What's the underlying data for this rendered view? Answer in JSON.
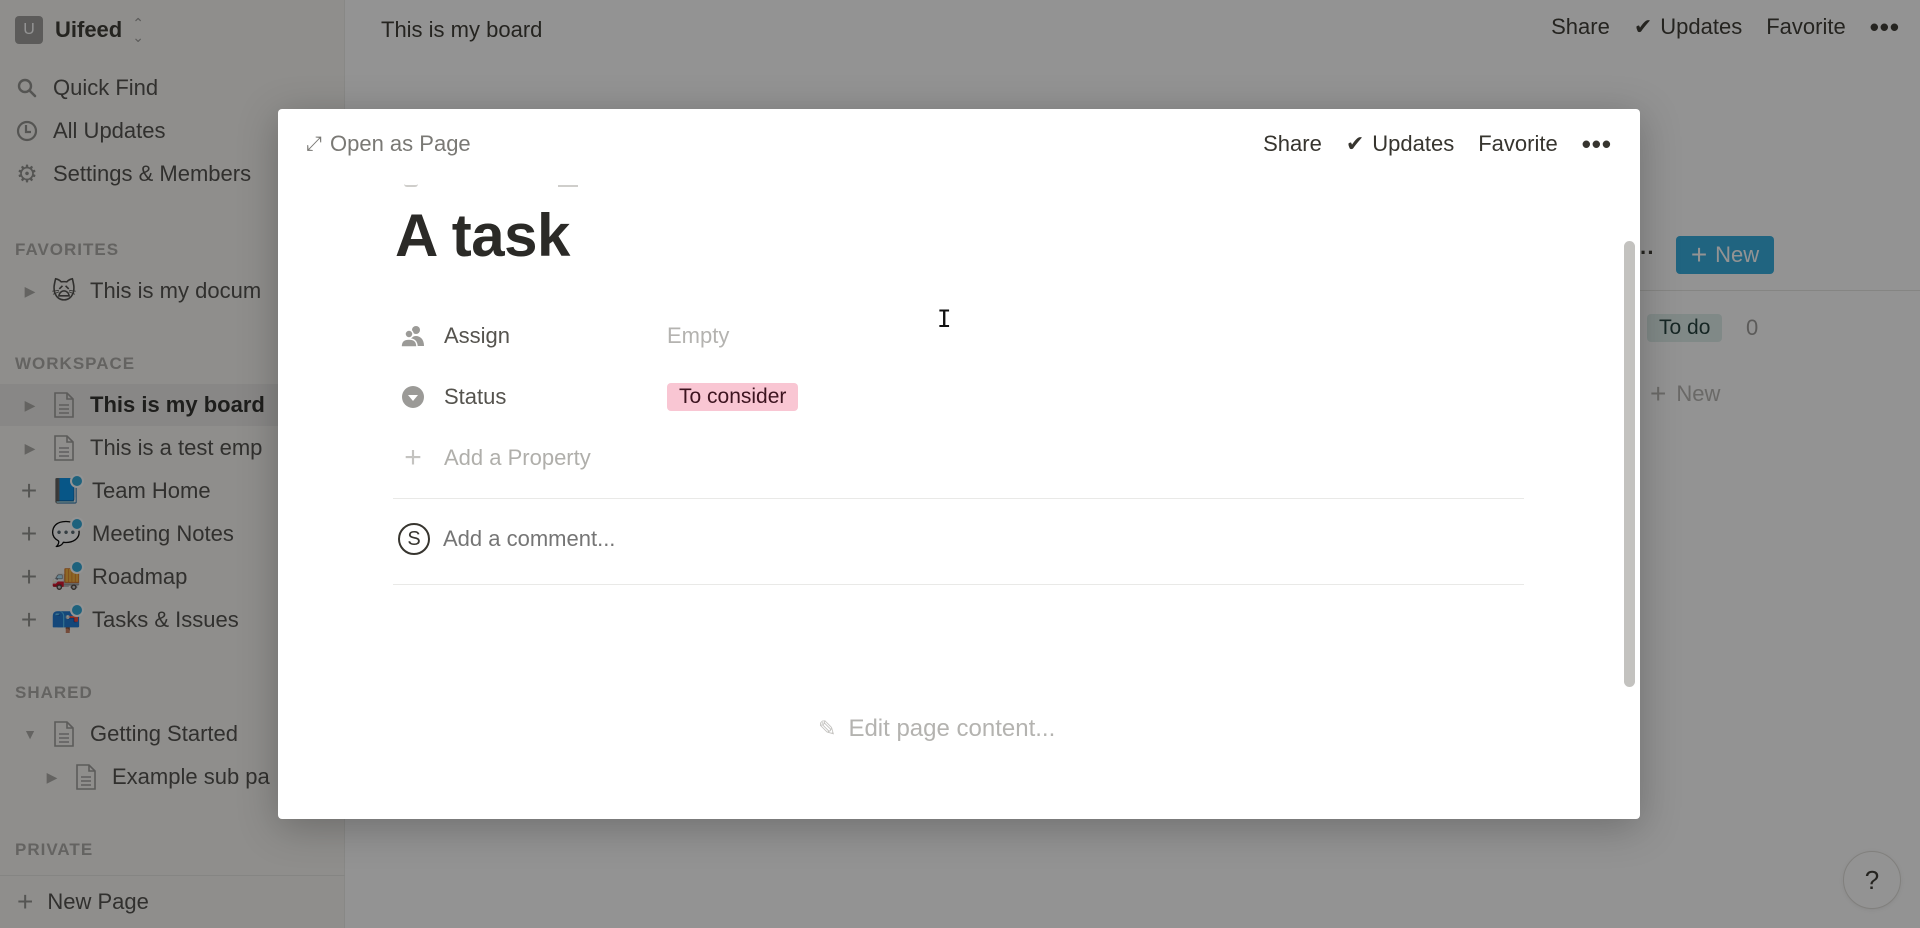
{
  "sidebar": {
    "workspace": {
      "initial": "U",
      "name": "Uifeed"
    },
    "nav": [
      {
        "label": "Quick Find",
        "icon": "search-icon"
      },
      {
        "label": "All Updates",
        "icon": "clock-icon"
      },
      {
        "label": "Settings & Members",
        "icon": "gear-icon"
      }
    ],
    "sections": {
      "favorites": "FAVORITES",
      "workspace": "WORKSPACE",
      "shared": "SHARED",
      "private": "PRIVATE"
    },
    "favorites": [
      {
        "label": "This is my docum",
        "icon": "scared-cat-emoji",
        "emoji": "🙀"
      }
    ],
    "workspace_items": [
      {
        "label": "This is my board",
        "icon": "page-icon",
        "active": true
      },
      {
        "label": "This is a test emp",
        "icon": "page-icon"
      },
      {
        "label": "Team Home",
        "icon": "book-icon",
        "emoji": "📘"
      },
      {
        "label": "Meeting Notes",
        "icon": "speech-bubble-icon",
        "emoji": "💬"
      },
      {
        "label": "Roadmap",
        "icon": "truck-icon",
        "emoji": "🚚"
      },
      {
        "label": "Tasks & Issues",
        "icon": "mailbox-icon",
        "emoji": "📪"
      }
    ],
    "shared_items": [
      {
        "label": "Getting Started",
        "icon": "page-icon",
        "expanded": true
      },
      {
        "label": "Example sub pa",
        "icon": "page-icon"
      }
    ],
    "new_page": "New Page"
  },
  "topbar": {
    "title": "This is my board",
    "share": "Share",
    "updates": "Updates",
    "favorite": "Favorite",
    "more": "•••"
  },
  "board": {
    "new_button": "New",
    "column": {
      "name": "To do",
      "count": "0",
      "color": "#ddedea"
    },
    "add_new": "New"
  },
  "modal": {
    "open_as_page": "Open as Page",
    "share": "Share",
    "updates": "Updates",
    "favorite": "Favorite",
    "more": "•••",
    "title": "A task",
    "properties": [
      {
        "label": "Assign",
        "value": "Empty",
        "icon": "people-icon"
      },
      {
        "label": "Status",
        "value": "To consider",
        "icon": "select-icon",
        "color": "#f9c6d3"
      }
    ],
    "add_property": "Add a Property",
    "comment": {
      "avatar": "S",
      "placeholder": "Add a comment..."
    },
    "edit_content": "Edit page content..."
  },
  "help": "?"
}
